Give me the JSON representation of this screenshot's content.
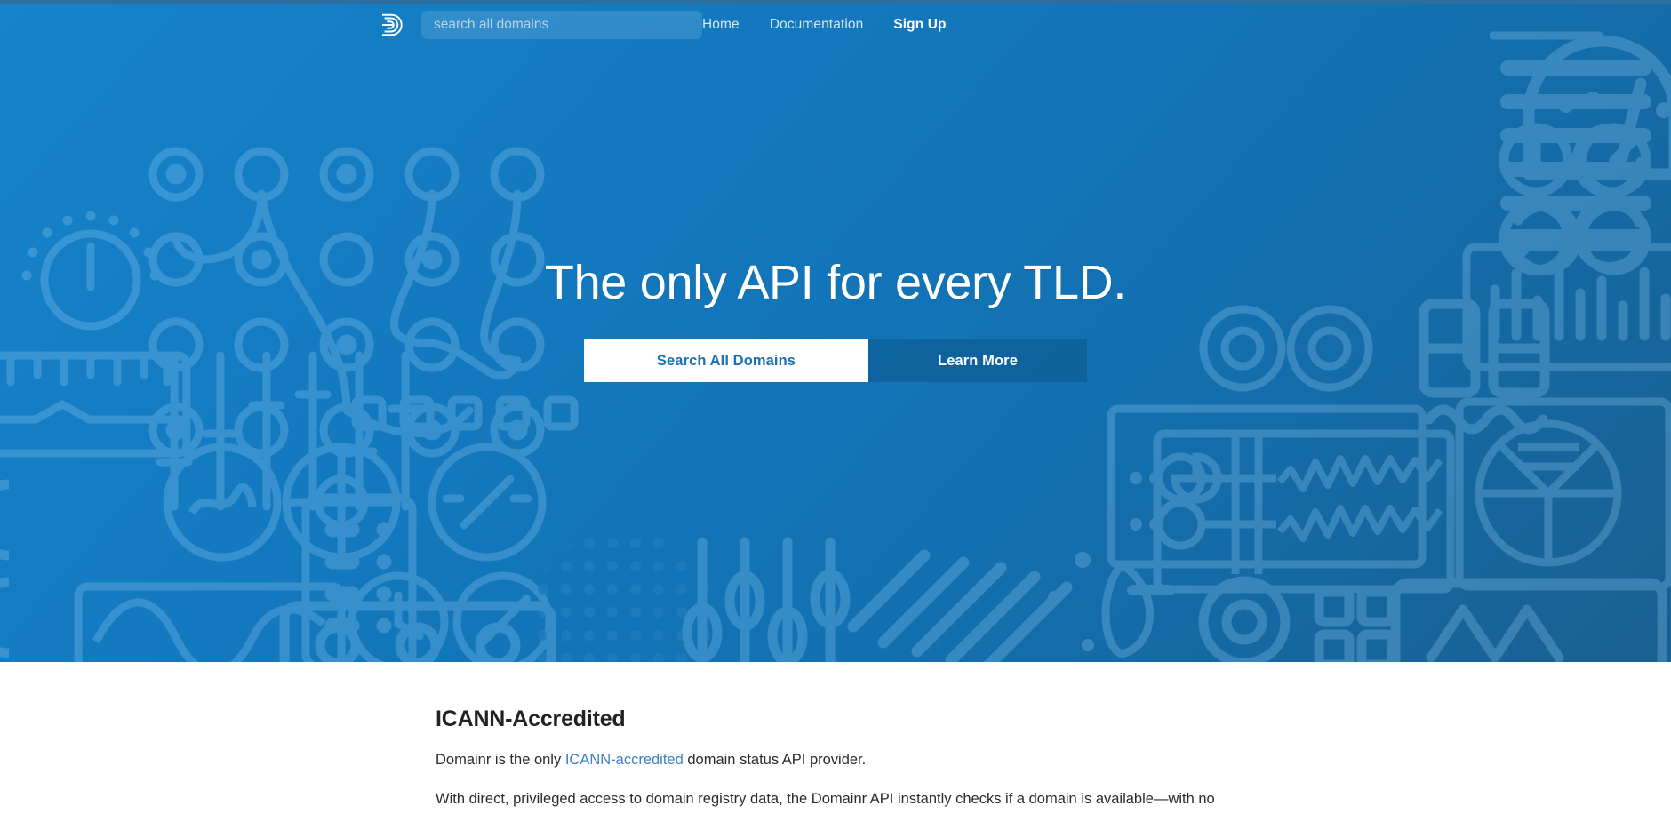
{
  "site": {
    "brand": "Domainr",
    "logo_icon": "domainr-d-logo-icon"
  },
  "navbar": {
    "search": {
      "placeholder": "search all domains",
      "value": ""
    },
    "links": [
      {
        "label": "Home",
        "strong": false
      },
      {
        "label": "Documentation",
        "strong": false
      },
      {
        "label": "Sign Up",
        "strong": true
      }
    ]
  },
  "hero": {
    "headline": "The only API for every TLD.",
    "buttons": {
      "primary": "Search All Domains",
      "secondary": "Learn More"
    },
    "background": {
      "pattern": "technical-instrument-line-icons",
      "gradient_from": "#1683cb",
      "gradient_to": "#195f91"
    }
  },
  "content": {
    "title": "ICANN-Accredited",
    "paragraph1": {
      "before": "Domainr is the only ",
      "link": "ICANN-accredited",
      "after": " domain status API provider."
    },
    "paragraph2": "With direct, privileged access to domain registry data, the Domainr API instantly checks if a domain is available—with no"
  },
  "colors": {
    "hero_blue": "#1278be",
    "hero_blue_dark": "#195f91",
    "accent_link": "#3d82c4",
    "button_primary_text": "#1a72b4",
    "top_edge": "#2d6e9e"
  }
}
